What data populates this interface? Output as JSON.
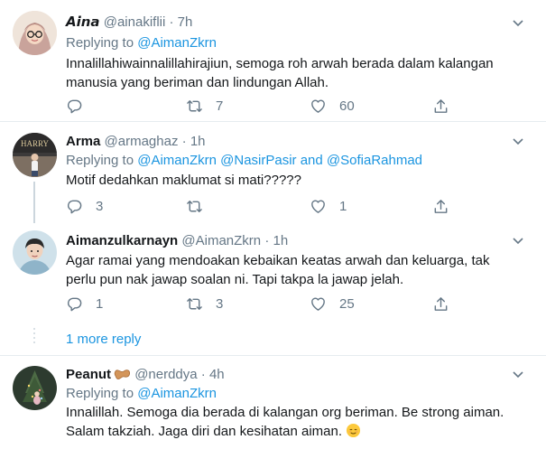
{
  "tweets": [
    {
      "display_name": "𝘼𝙞𝙣𝙖",
      "handle": "@ainakiflii",
      "time": "7h",
      "replying_prefix": "Replying to",
      "replying_to": "@AimanZkrn",
      "text": "Innalillahiwainnalillahirajiun, semoga roh arwah berada dalam kalangan manusia yang beriman dan lindungan Allah.",
      "replies": "",
      "retweets": "7",
      "likes": "60"
    },
    {
      "display_name": "Arma",
      "handle": "@armaghaz",
      "time": "1h",
      "replying_prefix": "Replying to",
      "replying_to": "@AimanZkrn @NasirPasir and @SofiaRahmad",
      "text": "Motif dedahkan maklumat si mati?????",
      "replies": "3",
      "retweets": "",
      "likes": "1"
    },
    {
      "display_name": "Aimanzulkarnayn",
      "handle": "@AimanZkrn",
      "time": "1h",
      "text": "Agar ramai yang mendoakan kebaikan keatas arwah dan keluarga, tak perlu pun nak jawap soalan ni. Tapi takpa la jawap jelah.",
      "replies": "1",
      "retweets": "3",
      "likes": "25"
    },
    {
      "display_name": "Peanut",
      "handle": "@nerddya",
      "time": "4h",
      "replying_prefix": "Replying to",
      "replying_to": "@AimanZkrn",
      "text": "Innalillah. Semoga dia berada di kalangan org beriman. Be strong aiman. Salam takziah. Jaga diri dan kesihatan aiman."
    }
  ],
  "more_reply_label": "1 more reply",
  "icons": {
    "reply": "reply-icon",
    "retweet": "retweet-icon",
    "like": "heart-icon",
    "share": "share-icon",
    "menu": "chevron-down-icon",
    "peanut": "peanut-emoji",
    "smile": "relieved-face-emoji"
  },
  "colors": {
    "link": "#1b95e0",
    "muted": "#657786",
    "separator": "#e6ecf0"
  }
}
